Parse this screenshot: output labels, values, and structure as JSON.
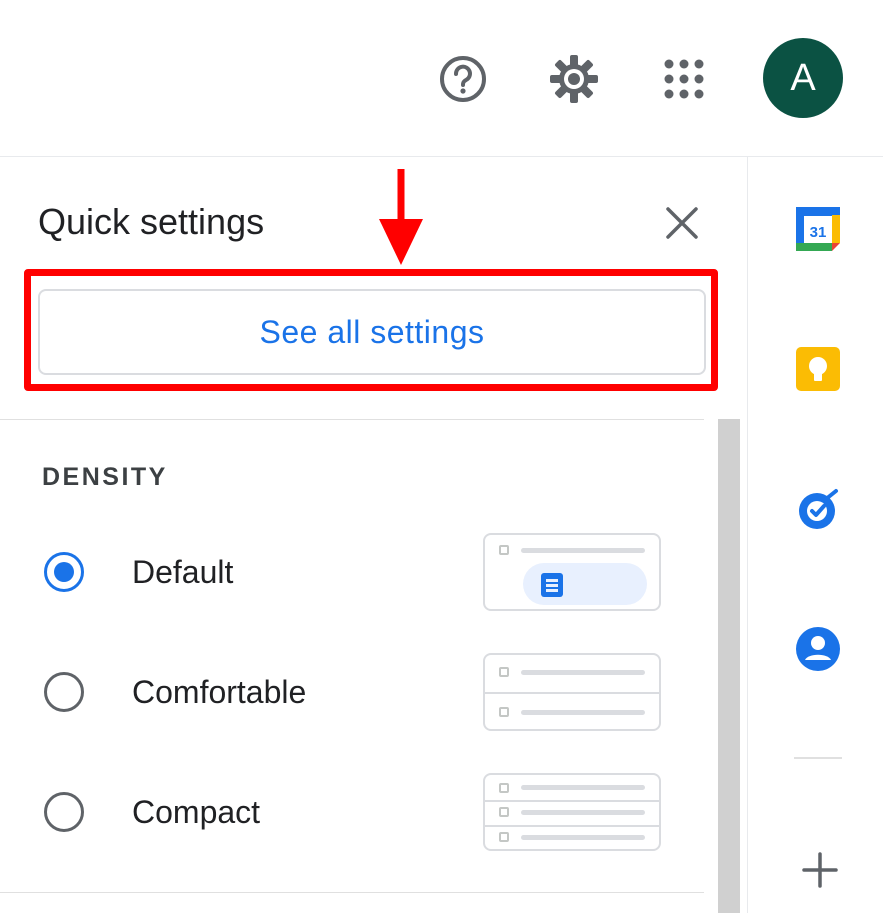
{
  "header": {
    "help_icon": "help-circle-icon",
    "settings_icon": "gear-icon",
    "apps_icon": "apps-grid-icon",
    "avatar_initial": "A",
    "avatar_color": "#0b5243"
  },
  "quick_settings": {
    "title": "Quick settings",
    "close_icon": "close-icon",
    "see_all_label": "See all settings",
    "accent_color": "#1a73e8",
    "highlight_color": "#ff0000",
    "density": {
      "title": "DENSITY",
      "options": [
        {
          "label": "Default",
          "selected": true
        },
        {
          "label": "Comfortable",
          "selected": false
        },
        {
          "label": "Compact",
          "selected": false
        }
      ]
    }
  },
  "side_panel": {
    "apps": [
      {
        "name": "calendar-icon",
        "text": "31"
      },
      {
        "name": "keep-icon"
      },
      {
        "name": "tasks-icon"
      },
      {
        "name": "contacts-icon"
      }
    ],
    "add_icon": "plus-icon"
  }
}
